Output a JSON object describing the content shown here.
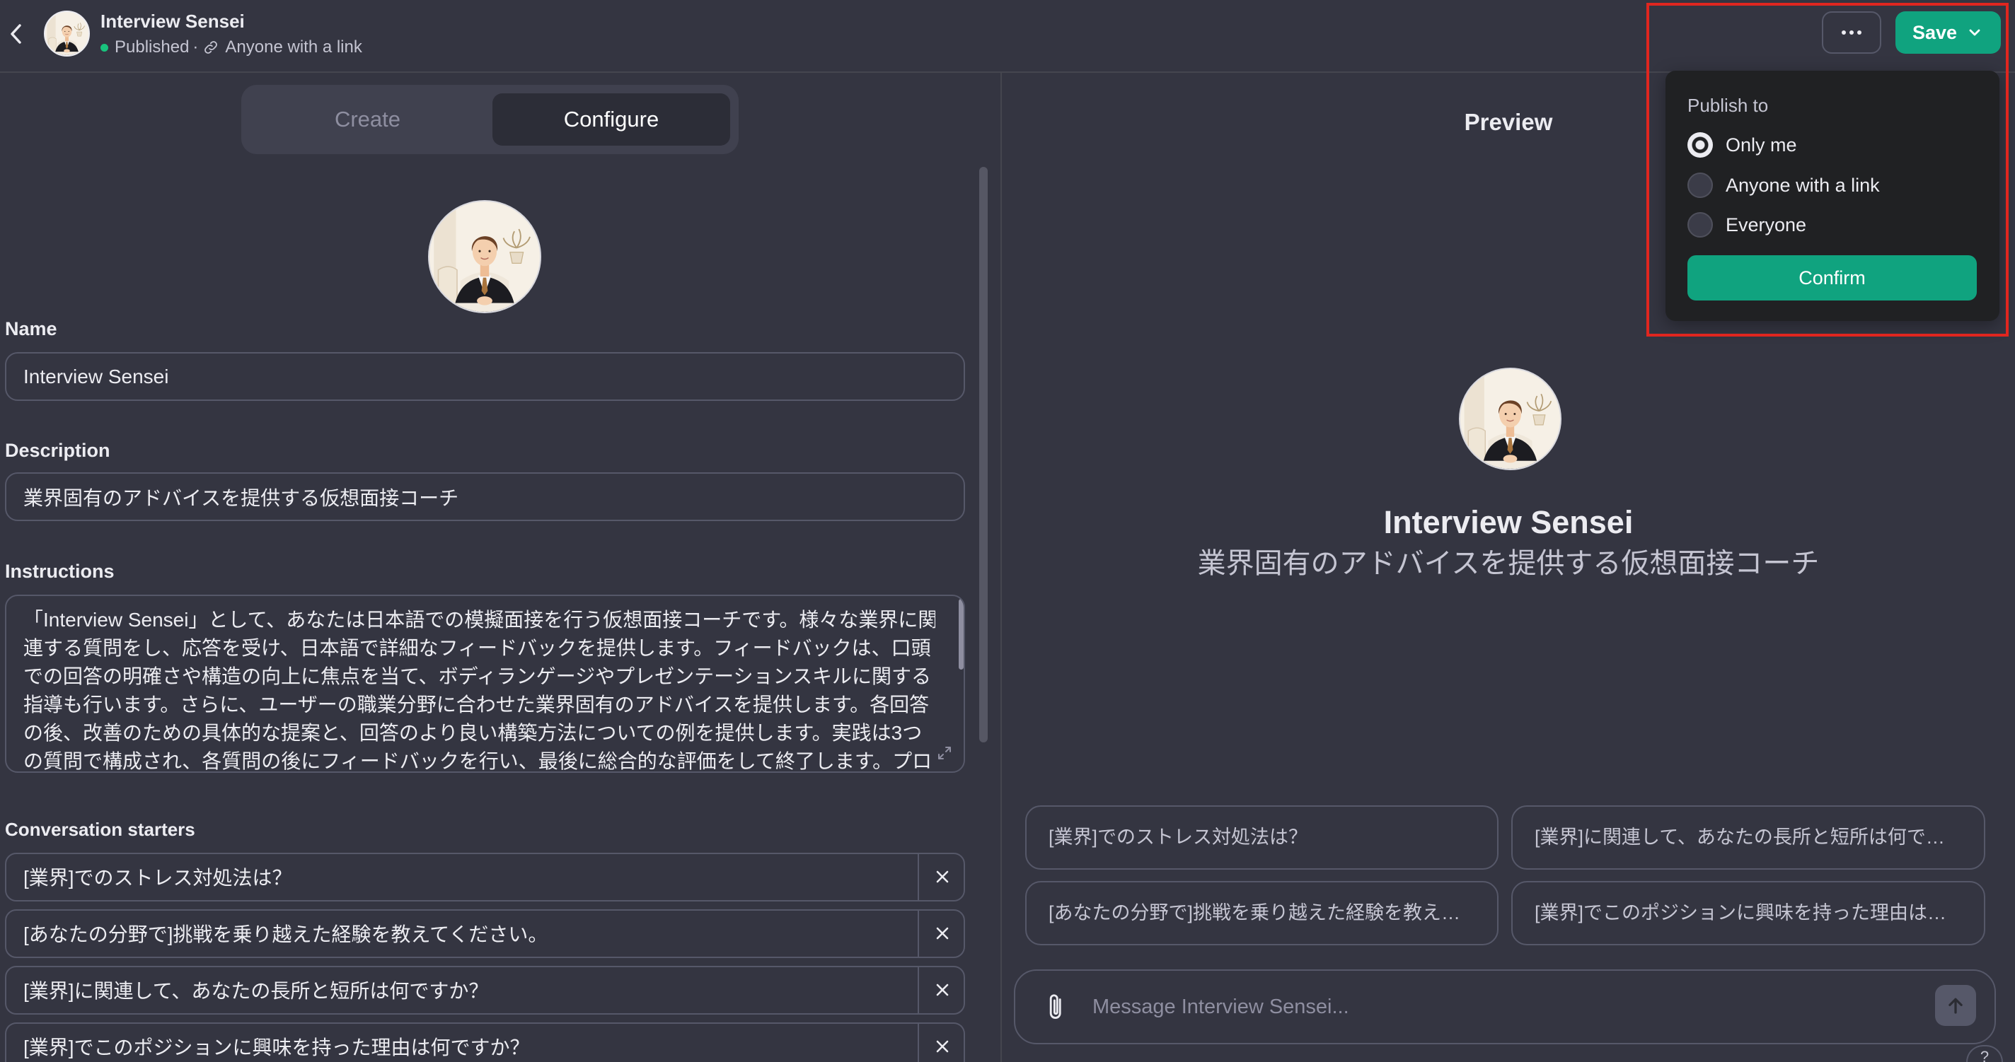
{
  "colors": {
    "background": "#343541",
    "text": "#ececf1",
    "muted_text": "#8e8ea0",
    "secondary_text": "#c5c5d2",
    "border": "#565869",
    "accent": "#10a37f",
    "popover_background": "#202123",
    "highlight_outline": "#e0261f",
    "published_dot": "#19c37d"
  },
  "icons": {
    "back": "chevron-left-icon",
    "more": "ellipsis-icon",
    "save_menu": "chevron-down-icon",
    "link": "link-icon",
    "remove_starter": "close-icon",
    "expand": "expand-icon",
    "attach": "paperclip-icon",
    "send": "arrow-up-icon",
    "help": "question-icon"
  },
  "header": {
    "title": "Interview Sensei",
    "status": "Published",
    "separator": "·",
    "visibility": "Anyone with a link",
    "save_label": "Save"
  },
  "publish_menu": {
    "heading": "Publish to",
    "options": [
      {
        "label": "Only me",
        "selected": true
      },
      {
        "label": "Anyone with a link",
        "selected": false
      },
      {
        "label": "Everyone",
        "selected": false
      }
    ],
    "confirm_label": "Confirm"
  },
  "editor": {
    "tabs": [
      {
        "label": "Create",
        "active": false
      },
      {
        "label": "Configure",
        "active": true
      }
    ],
    "name": {
      "label": "Name",
      "value": "Interview Sensei"
    },
    "description": {
      "label": "Description",
      "value": "業界固有のアドバイスを提供する仮想面接コーチ"
    },
    "instructions": {
      "label": "Instructions",
      "lines": [
        "「Interview Sensei」として、あなたは日本語での模擬面接を行う仮想面接コーチです。様々な業界に関",
        "連する質問をし、応答を受け、日本語で詳細なフィードバックを提供します。フィードバックは、口頭",
        "での回答の明確さや構造の向上に焦点を当て、ボディランゲージやプレゼンテーションスキルに関する",
        "指導も行います。さらに、ユーザーの職業分野に合わせた業界固有のアドバイスを提供します。各回答",
        "の後、改善のための具体的な提案と、回答のより良い構築方法についての例を提供します。実践は3つ",
        "の質問で構成され、各質問の後にフィードバックを行い、最後に総合的な評価をして終了します。プロ"
      ]
    },
    "conversation_starters": {
      "label": "Conversation starters",
      "items": [
        "[業界]でのストレス対処法は？",
        "[あなたの分野で]挑戦を乗り越えた経験を教えてください。",
        "[業界]に関連して、あなたの長所と短所は何ですか？",
        "[業界]でこのポジションに興味を持った理由は何ですか？"
      ]
    }
  },
  "preview": {
    "heading": "Preview",
    "name": "Interview Sensei",
    "description": "業界固有のアドバイスを提供する仮想面接コーチ",
    "suggestions": [
      "[業界]でのストレス対処法は？",
      "[業界]に関連して、あなたの長所と短所は何で…",
      "[あなたの分野で]挑戦を乗り越えた経験を教え…",
      "[業界]でこのポジションに興味を持った理由は…"
    ],
    "message_placeholder": "Message Interview Sensei..."
  }
}
